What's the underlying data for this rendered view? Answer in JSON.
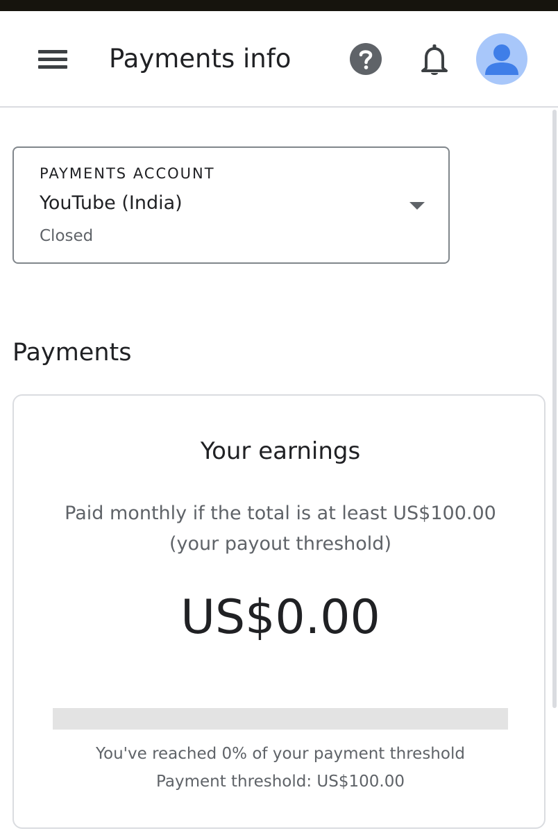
{
  "app_bar": {
    "title": "Payments info",
    "menu_icon": "menu-icon",
    "help_icon": "help-icon",
    "notifications_icon": "bell-icon",
    "avatar_icon": "account-avatar"
  },
  "payments_account": {
    "label": "PAYMENTS ACCOUNT",
    "name": "YouTube (India)",
    "status": "Closed",
    "dropdown_icon": "chevron-down-icon"
  },
  "payments": {
    "heading": "Payments",
    "card": {
      "title": "Your earnings",
      "description_line1": "Paid monthly if the total is at least US$100.00",
      "description_line2": "(your payout threshold)",
      "amount": "US$0.00",
      "progress_percent": 0,
      "reached_text": "You've reached 0% of your payment threshold",
      "threshold_text": "Payment threshold: US$100.00"
    }
  },
  "colors": {
    "accent": "#1a73e8",
    "avatar_bg": "#a8c7fa",
    "avatar_fg": "#3f7ee8",
    "icon_dark": "#5f6368",
    "progress_track": "#e3e3e3"
  }
}
